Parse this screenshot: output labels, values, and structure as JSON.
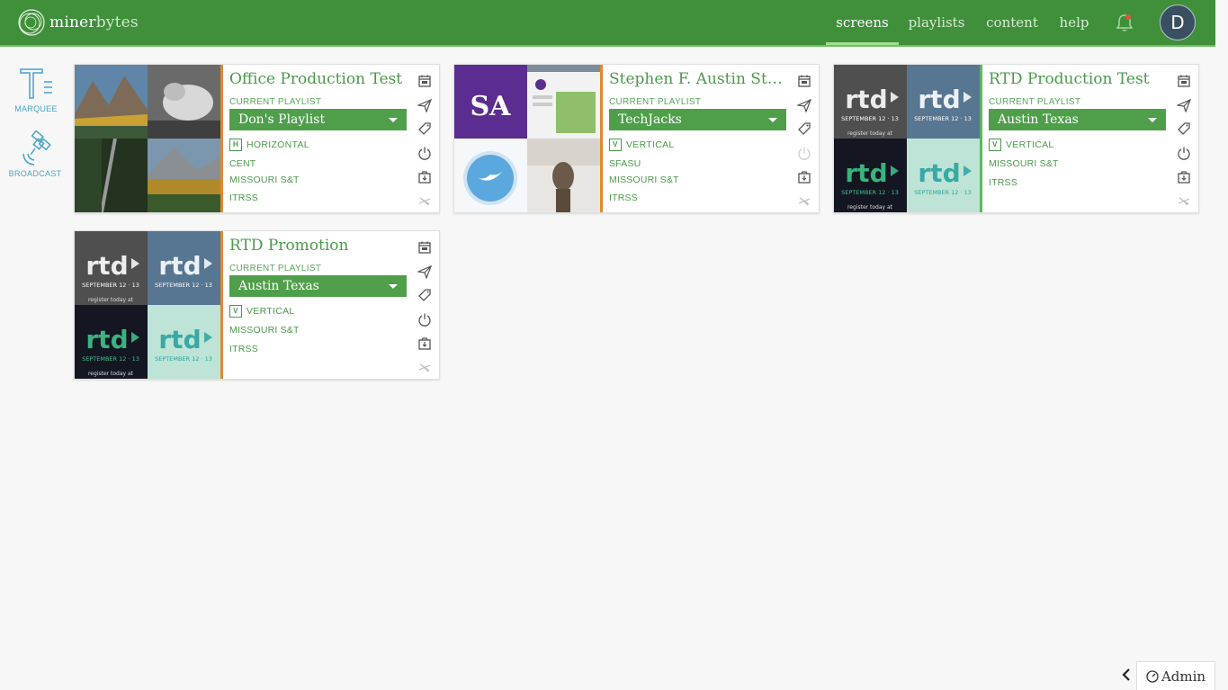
{
  "brand": {
    "name_strong": "miner",
    "name_light": "bytes"
  },
  "nav": [
    {
      "label": "screens",
      "active": true
    },
    {
      "label": "playlists",
      "active": false
    },
    {
      "label": "content",
      "active": false
    },
    {
      "label": "help",
      "active": false
    }
  ],
  "user": {
    "initial": "D"
  },
  "sidebar": [
    {
      "label": "MARQUEE",
      "icon": "marquee-icon"
    },
    {
      "label": "BROADCAST",
      "icon": "broadcast-satellite-icon"
    }
  ],
  "playlist_label": "CURRENT PLAYLIST",
  "screens": [
    {
      "title": "Office Production Test",
      "playlist": "Don's Playlist",
      "orientation_badge": "H",
      "orientation": "HORIZONTAL",
      "tags": [
        "CENT",
        "MISSOURI S&T",
        "ITRSS"
      ],
      "accent": "#e08a2e",
      "thumbs": "landscape",
      "power_on": true
    },
    {
      "title": "Stephen F. Austin Sta...",
      "playlist": "TechJacks",
      "orientation_badge": "V",
      "orientation": "VERTICAL",
      "tags": [
        "SFASU",
        "MISSOURI S&T",
        "ITRSS"
      ],
      "accent": "#e08a2e",
      "thumbs": "sfa",
      "power_on": false
    },
    {
      "title": "RTD Production Test",
      "playlist": "Austin Texas",
      "orientation_badge": "V",
      "orientation": "VERTICAL",
      "tags": [
        "MISSOURI S&T",
        "ITRSS"
      ],
      "accent": "#5cb85c",
      "thumbs": "rtd",
      "power_on": true
    },
    {
      "title": "RTD Promotion",
      "playlist": "Austin Texas",
      "orientation_badge": "V",
      "orientation": "VERTICAL",
      "tags": [
        "MISSOURI S&T",
        "ITRSS"
      ],
      "accent": "#e08a2e",
      "thumbs": "rtd",
      "power_on": true
    }
  ],
  "rtd_thumb": {
    "brand": "rtd",
    "date": "SEPTEMBER 12 · 13",
    "note": "register today at"
  },
  "admin": {
    "label": "Admin"
  },
  "colors": {
    "topbar": "#3f8f3b",
    "accent_green": "#4f9f4a",
    "accent_orange": "#e08a2e",
    "link_blue": "#4aa3c6"
  }
}
